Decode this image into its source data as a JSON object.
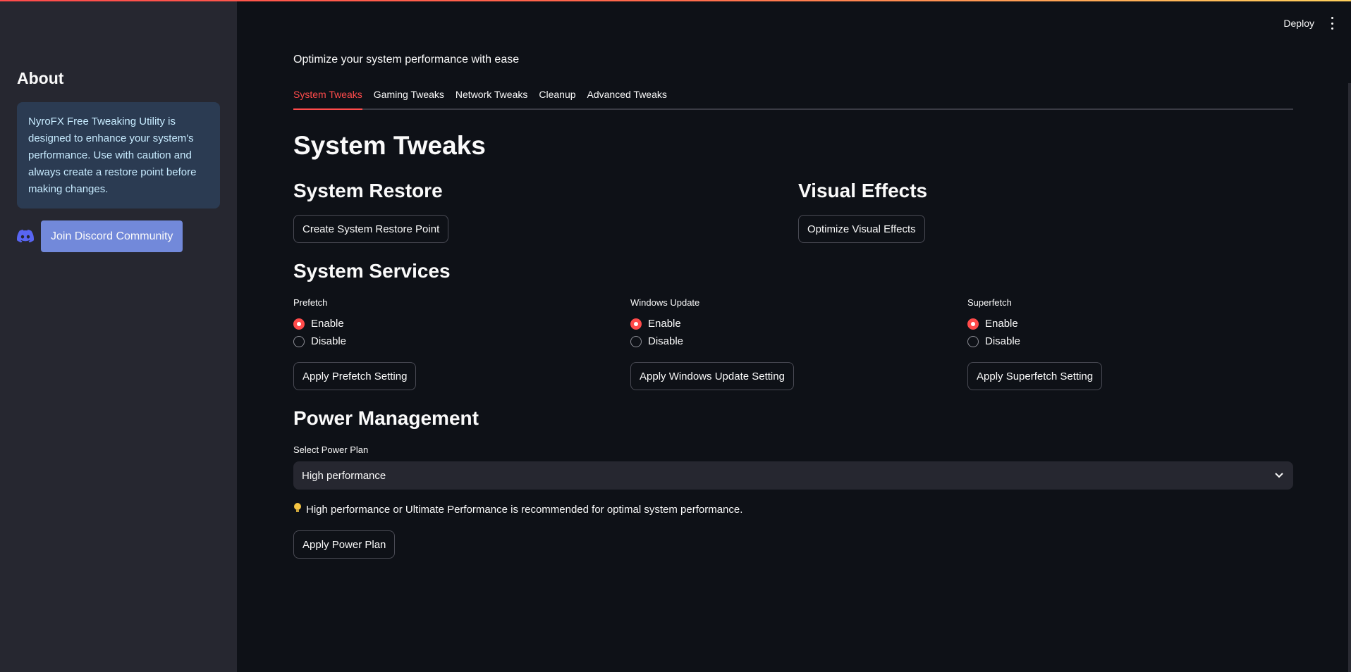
{
  "sidebar": {
    "about_title": "About",
    "about_text": "NyroFX Free Tweaking Utility is designed to enhance your system's performance. Use with caution and always create a restore point before making changes.",
    "discord_button": "Join Discord Community"
  },
  "header": {
    "deploy_label": "Deploy"
  },
  "main": {
    "subtitle": "Optimize your system performance with ease",
    "tabs": [
      {
        "label": "System Tweaks",
        "active": true
      },
      {
        "label": "Gaming Tweaks",
        "active": false
      },
      {
        "label": "Network Tweaks",
        "active": false
      },
      {
        "label": "Cleanup",
        "active": false
      },
      {
        "label": "Advanced Tweaks",
        "active": false
      }
    ],
    "page_title": "System Tweaks",
    "restore": {
      "heading": "System Restore",
      "button": "Create System Restore Point"
    },
    "visual": {
      "heading": "Visual Effects",
      "button": "Optimize Visual Effects"
    },
    "services": {
      "heading": "System Services",
      "groups": [
        {
          "label": "Prefetch",
          "options": [
            "Enable",
            "Disable"
          ],
          "selected": "Enable",
          "button": "Apply Prefetch Setting"
        },
        {
          "label": "Windows Update",
          "options": [
            "Enable",
            "Disable"
          ],
          "selected": "Enable",
          "button": "Apply Windows Update Setting"
        },
        {
          "label": "Superfetch",
          "options": [
            "Enable",
            "Disable"
          ],
          "selected": "Enable",
          "button": "Apply Superfetch Setting"
        }
      ]
    },
    "power": {
      "heading": "Power Management",
      "select_label": "Select Power Plan",
      "selected_plan": "High performance",
      "note": "High performance or Ultimate Performance is recommended for optimal system performance.",
      "button": "Apply Power Plan"
    }
  },
  "colors": {
    "accent": "#ff4b4b",
    "background": "#0e1117",
    "sidebar": "#262730",
    "info_box": "#2b3b52",
    "discord": "#7289da"
  }
}
